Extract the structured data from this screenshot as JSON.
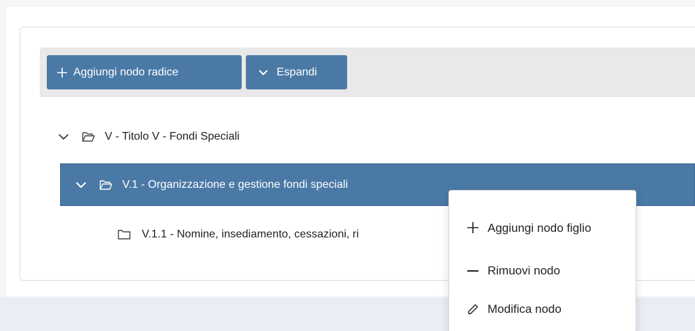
{
  "toolbar": {
    "add_root_label": "Aggiungi nodo radice",
    "add_root_icon": "plus-icon",
    "expand_label": "Espandi",
    "expand_icon": "chevron-down-icon",
    "button_color": "#4a79a6"
  },
  "tree": {
    "nodes": [
      {
        "label": "V - Titolo V - Fondi Speciali",
        "expanded": true,
        "icon": "folder-open-icon"
      },
      {
        "label": "V.1 - Organizzazione e gestione fondi speciali",
        "expanded": true,
        "selected": true,
        "icon": "folder-open-icon"
      },
      {
        "label": "V.1.1 - Nomine, insediamento, cessazioni, ri",
        "icon": "folder-icon"
      }
    ],
    "selected_color": "#4a79a6"
  },
  "context_menu": {
    "items": [
      {
        "label": "Aggiungi nodo figlio",
        "icon": "plus-icon"
      },
      {
        "label": "Rimuovi nodo",
        "icon": "minus-icon"
      },
      {
        "label": "Modifica nodo",
        "icon": "pencil-icon"
      }
    ]
  }
}
